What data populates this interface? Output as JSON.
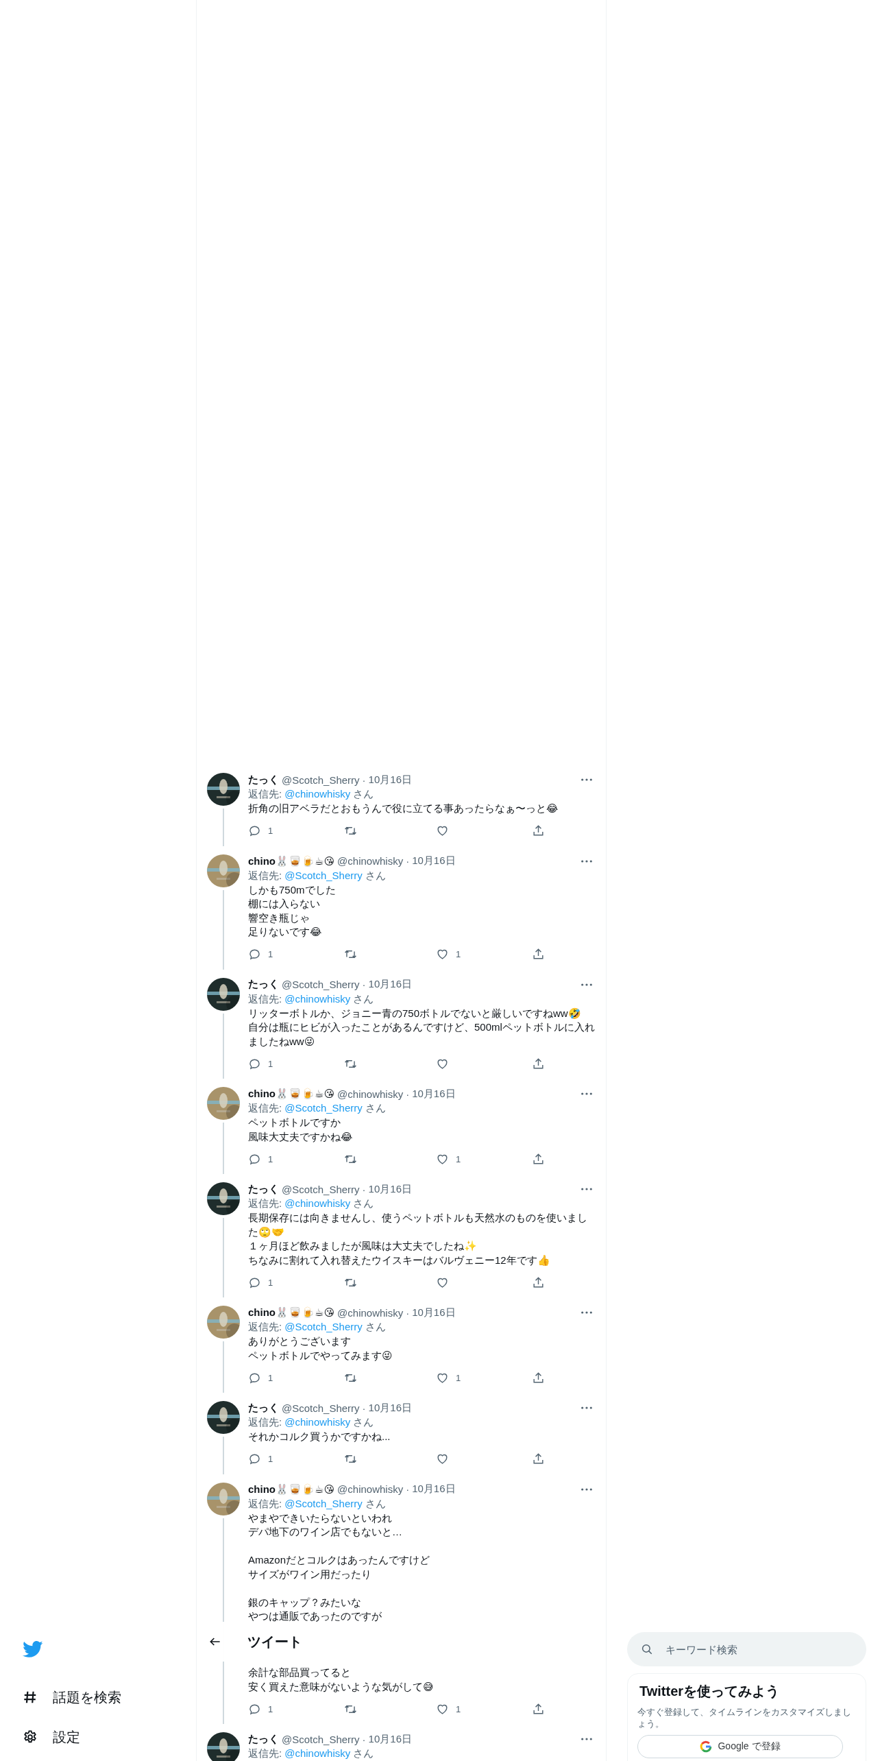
{
  "nav": {
    "items": [
      {
        "kind": "explore",
        "label": "話題を検索"
      },
      {
        "kind": "settings",
        "label": "設定"
      }
    ]
  },
  "header": {
    "title": "ツイート"
  },
  "tweets": [
    {
      "name": "たっく",
      "handle": "@Scotch_Sherry",
      "date": "10月16日",
      "reply_label": "返信先:",
      "reply_to": "@chinowhisky",
      "reply_suffix": "さん",
      "avatar": {
        "kind": "picture",
        "color": "#1f2d2c"
      },
      "paragraphs": [
        {
          "lines": [
            "折角の旧アベラだとおもうんで役に立てる事あったらなぁ〜っと😂"
          ]
        }
      ],
      "replies": "1"
    },
    {
      "name": "chino🐰🥃🍺☕😘",
      "handle": "@chinowhisky",
      "date": "10月16日",
      "reply_label": "返信先:",
      "reply_to": "@Scotch_Sherry",
      "reply_suffix": "さん",
      "avatar": {
        "kind": "picture",
        "color": "#a8936a"
      },
      "paragraphs": [
        {
          "lines": [
            "しかも750mでした",
            "棚には入らない",
            "響空き瓶じゃ",
            "足りないです😂"
          ]
        }
      ],
      "replies": "1",
      "likes": "1"
    },
    {
      "name": "たっく",
      "handle": "@Scotch_Sherry",
      "date": "10月16日",
      "reply_label": "返信先:",
      "reply_to": "@chinowhisky",
      "reply_suffix": "さん",
      "avatar": {
        "kind": "picture",
        "color": "#1f2d2c"
      },
      "paragraphs": [
        {
          "lines": [
            "リッターボトルか、ジョニー青の750ボトルでないと厳しいですねww🤣",
            "自分は瓶にヒビが入ったことがあるんですけど、500mlペットボトルに入れましたねww😜"
          ]
        }
      ],
      "replies": "1"
    },
    {
      "name": "chino🐰🥃🍺☕😘",
      "handle": "@chinowhisky",
      "date": "10月16日",
      "reply_label": "返信先:",
      "reply_to": "@Scotch_Sherry",
      "reply_suffix": "さん",
      "avatar": {
        "kind": "picture",
        "color": "#a8936a"
      },
      "paragraphs": [
        {
          "lines": [
            "ペットボトルですか",
            "風味大丈夫ですかね😂"
          ]
        }
      ],
      "replies": "1",
      "likes": "1"
    },
    {
      "name": "たっく",
      "handle": "@Scotch_Sherry",
      "date": "10月16日",
      "reply_label": "返信先:",
      "reply_to": "@chinowhisky",
      "reply_suffix": "さん",
      "avatar": {
        "kind": "picture",
        "color": "#1f2d2c"
      },
      "paragraphs": [
        {
          "lines": [
            "長期保存には向きませんし、使うペットボトルも天然水のものを使いました🙄🤝",
            "１ヶ月ほど飲みましたが風味は大丈夫でしたね✨",
            "ちなみに割れて入れ替えたウイスキーはバルヴェニー12年です👍"
          ]
        }
      ],
      "replies": "1"
    },
    {
      "name": "chino🐰🥃🍺☕😘",
      "handle": "@chinowhisky",
      "date": "10月16日",
      "reply_label": "返信先:",
      "reply_to": "@Scotch_Sherry",
      "reply_suffix": "さん",
      "avatar": {
        "kind": "picture",
        "color": "#a8936a"
      },
      "paragraphs": [
        {
          "lines": [
            "ありがとうございます",
            "ペットボトルでやってみます😜"
          ]
        }
      ],
      "replies": "1",
      "likes": "1"
    },
    {
      "name": "たっく",
      "handle": "@Scotch_Sherry",
      "date": "10月16日",
      "reply_label": "返信先:",
      "reply_to": "@chinowhisky",
      "reply_suffix": "さん",
      "avatar": {
        "kind": "picture",
        "color": "#1f2d2c"
      },
      "paragraphs": [
        {
          "lines": [
            "それかコルク買うかですかね..."
          ]
        }
      ],
      "replies": "1"
    },
    {
      "name": "chino🐰🥃🍺☕😘",
      "handle": "@chinowhisky",
      "date": "10月16日",
      "reply_label": "返信先:",
      "reply_to": "@Scotch_Sherry",
      "reply_suffix": "さん",
      "avatar": {
        "kind": "picture",
        "color": "#a8936a"
      },
      "paragraphs": [
        {
          "lines": [
            "やまやできいたらないといわれ",
            "デパ地下のワイン店でもないと…"
          ]
        },
        {
          "lines": [
            "Amazonだとコルクはあったんですけど",
            "サイズがワイン用だったり"
          ]
        },
        {
          "lines": [
            "銀のキャップ？みたいな",
            "やつは通販であったのですが"
          ]
        },
        {
          "covered_above": true,
          "lines": [
            "余計な部品買ってると",
            "安く買えた意味がないような気がして😅"
          ]
        }
      ],
      "replies": "1",
      "likes": "1"
    },
    {
      "name": "たっく",
      "handle": "@Scotch_Sherry",
      "date": "10月16日",
      "reply_label": "返信先:",
      "reply_to": "@chinowhisky",
      "reply_suffix": "さん",
      "avatar": {
        "kind": "picture",
        "color": "#1f2d2c"
      }
    }
  ],
  "separator": "·",
  "search": {
    "placeholder": "キーワード検索"
  },
  "signup": {
    "title": "Twitterを使ってみよう",
    "text": "今すぐ登録して、タイムラインをカスタマイズしましょう。",
    "button": "Google で登録"
  }
}
